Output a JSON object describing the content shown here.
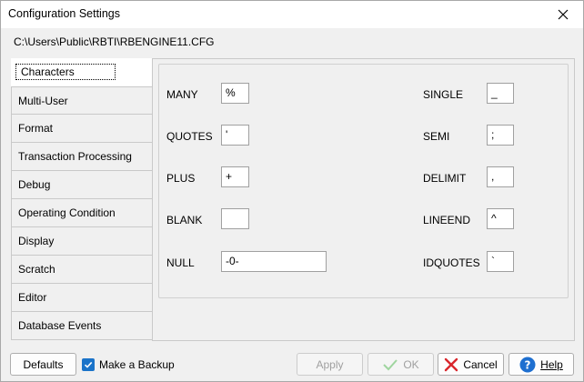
{
  "window": {
    "title": "Configuration Settings"
  },
  "file_path": "C:\\Users\\Public\\RBTI\\RBENGINE11.CFG",
  "sidebar": {
    "items": [
      {
        "label": "Characters",
        "selected": true
      },
      {
        "label": "Multi-User"
      },
      {
        "label": "Format"
      },
      {
        "label": "Transaction Processing"
      },
      {
        "label": "Debug"
      },
      {
        "label": "Operating Condition"
      },
      {
        "label": "Display"
      },
      {
        "label": "Scratch"
      },
      {
        "label": "Editor"
      },
      {
        "label": "Database Events"
      }
    ]
  },
  "fields": {
    "many": {
      "label": "MANY",
      "value": "%"
    },
    "quotes": {
      "label": "QUOTES",
      "value": "'"
    },
    "plus": {
      "label": "PLUS",
      "value": "+"
    },
    "blank": {
      "label": "BLANK",
      "value": ""
    },
    "null": {
      "label": "NULL",
      "value": "-0-"
    },
    "single": {
      "label": "SINGLE",
      "value": "_"
    },
    "semi": {
      "label": "SEMI",
      "value": ";"
    },
    "delimit": {
      "label": "DELIMIT",
      "value": ","
    },
    "lineend": {
      "label": "LINEEND",
      "value": "^"
    },
    "idquotes": {
      "label": "IDQUOTES",
      "value": "`"
    }
  },
  "buttons": {
    "defaults": "Defaults",
    "backup_label": "Make a Backup",
    "backup_checked": true,
    "apply": "Apply",
    "ok": "OK",
    "cancel": "Cancel",
    "help": "Help"
  },
  "colors": {
    "accent": "#1a73c9",
    "ok_check": "#6cc36c",
    "cancel_x": "#d9262c",
    "help_icon": "#1e6fd0"
  }
}
